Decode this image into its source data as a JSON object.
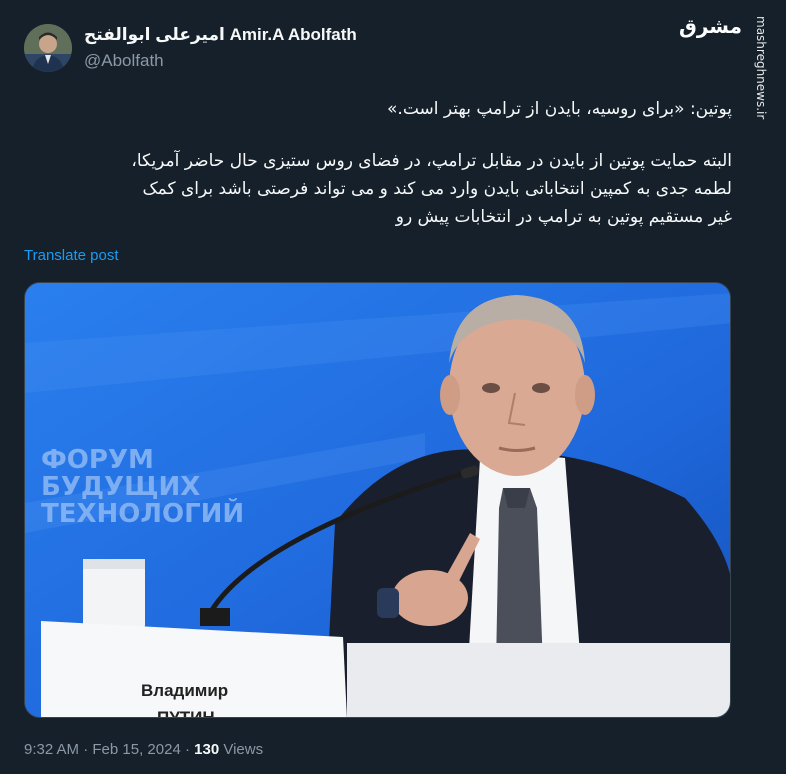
{
  "author": {
    "display_name": "امیرعلی ابوالفتح Amir.A Abolfath",
    "handle": "@Abolfath"
  },
  "watermark": {
    "logo": "مشرق",
    "site": "mashreghnews.ir"
  },
  "tweet": {
    "lines": [
      "پوتین: «برای روسیه، بایدن از ترامپ بهتر است.»",
      "البته حمایت پوتین از بایدن در مقابل ترامپ، در فضای روس ستیزی حال حاضر آمریکا،",
      "لطمه جدی به کمپین انتخاباتی بایدن وارد می کند و می تواند فرصتی باشد برای کمک",
      "غیر مستقیم پوتین به ترامپ در انتخابات پیش رو"
    ],
    "translate_label": "Translate post"
  },
  "media": {
    "backdrop_text": [
      "ФОРУМ",
      "БУДУЩИХ",
      "ТЕХНОЛОГИЙ"
    ],
    "nameplate": [
      "Владимир",
      "ПУТИН"
    ]
  },
  "meta": {
    "time": "9:32 AM",
    "separator": "·",
    "date": "Feb 15, 2024",
    "views_count": "130",
    "views_label": "Views"
  }
}
